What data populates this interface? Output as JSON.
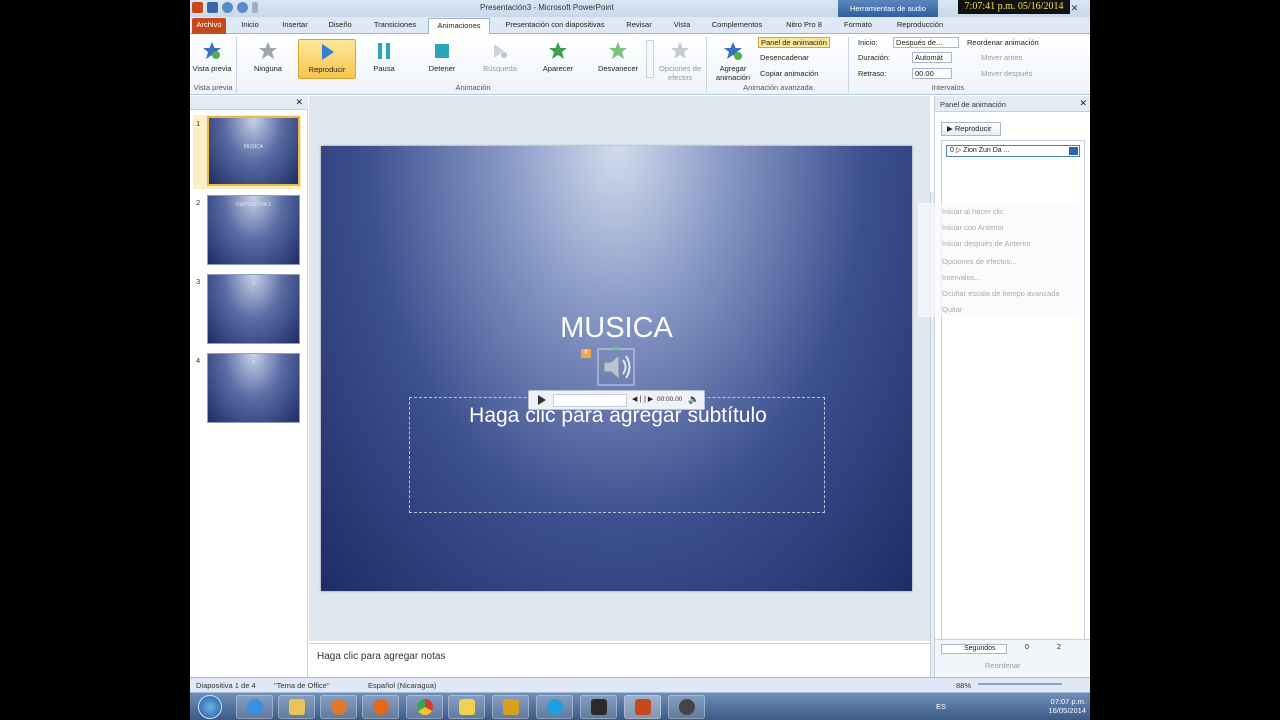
{
  "titlebar": {
    "title": "Presentación3  -  Microsoft PowerPoint",
    "context_tools": "Herramientas de audio",
    "clock": "7:07:41 p.m. 05/16/2014",
    "minimize": "–",
    "maximize": "❐",
    "close": "✕"
  },
  "tabs": [
    {
      "label": "Archivo"
    },
    {
      "label": "Inicio"
    },
    {
      "label": "Insertar"
    },
    {
      "label": "Diseño"
    },
    {
      "label": "Transiciones"
    },
    {
      "label": "Animaciones"
    },
    {
      "label": "Presentación con diapositivas"
    },
    {
      "label": "Revisar"
    },
    {
      "label": "Vista"
    },
    {
      "label": "Complementos"
    },
    {
      "label": "Nitro Pro 8"
    },
    {
      "label": "Formato"
    },
    {
      "label": "Reproducción"
    }
  ],
  "ribbon": {
    "preview": {
      "label": "Vista previa",
      "group": "Vista previa"
    },
    "animations": [
      {
        "label": "Ninguna"
      },
      {
        "label": "Reproducir"
      },
      {
        "label": "Pausa"
      },
      {
        "label": "Detener"
      },
      {
        "label": "Búsqueda"
      },
      {
        "label": "Aparecer"
      },
      {
        "label": "Desvanecer"
      }
    ],
    "effect_options": "Opciones de efectos",
    "animation_group": "Animación",
    "add_animation": "Agregar animación",
    "animation_pane": "Panel de animación",
    "trigger": "Desencadenar",
    "copy_animation": "Copiar animación",
    "advanced_group": "Animación avanzada",
    "start_label": "Inicio:",
    "start_value": "Después de...",
    "duration_label": "Duración:",
    "duration_value": "Automát",
    "delay_label": "Retraso:",
    "delay_value": "00.00",
    "reorder": "Reordenar animación",
    "move_earlier": "Mover antes",
    "move_later": "Mover después",
    "timing_group": "Intervalos"
  },
  "slides": [
    {
      "num": "1",
      "text": "MUSICA"
    },
    {
      "num": "2",
      "text": "DIAPOSITIVA 2"
    },
    {
      "num": "3",
      "text": "3"
    },
    {
      "num": "4",
      "text": "4"
    }
  ],
  "slide": {
    "title": "MUSICA",
    "subtitle": "Haga clic para agregar subtítulo",
    "anim_badge": "0",
    "player_time": "00:00.00"
  },
  "notes": "Haga clic para agregar notas",
  "anim_pane": {
    "title": "Panel de animación",
    "play": "Reproducir",
    "item": "0 ▷  Zion   Zun Da ...",
    "menu": [
      "Iniciar al hacer clic",
      "Iniciar con Anterior",
      "Iniciar después de Anterior",
      "Opciones de efectos...",
      "Intervalos...",
      "Ocultar escala de tiempo avanzada",
      "Quitar"
    ],
    "seconds": "Segundos",
    "scale_start": "0",
    "scale_end": "2",
    "reorder": "Reordenar"
  },
  "status": {
    "slide_info": "Diapositiva 1 de 4",
    "theme": "\"Tema de Office\"",
    "language": "Español (Nicaragua)",
    "zoom": "88%"
  },
  "taskbar": {
    "lang": "ES",
    "time": "07:07 p.m.",
    "date": "16/05/2014"
  },
  "colors": {
    "accent": "#c44a1d",
    "selected": "#f8c64d",
    "clock_text": "#f2e14a"
  }
}
